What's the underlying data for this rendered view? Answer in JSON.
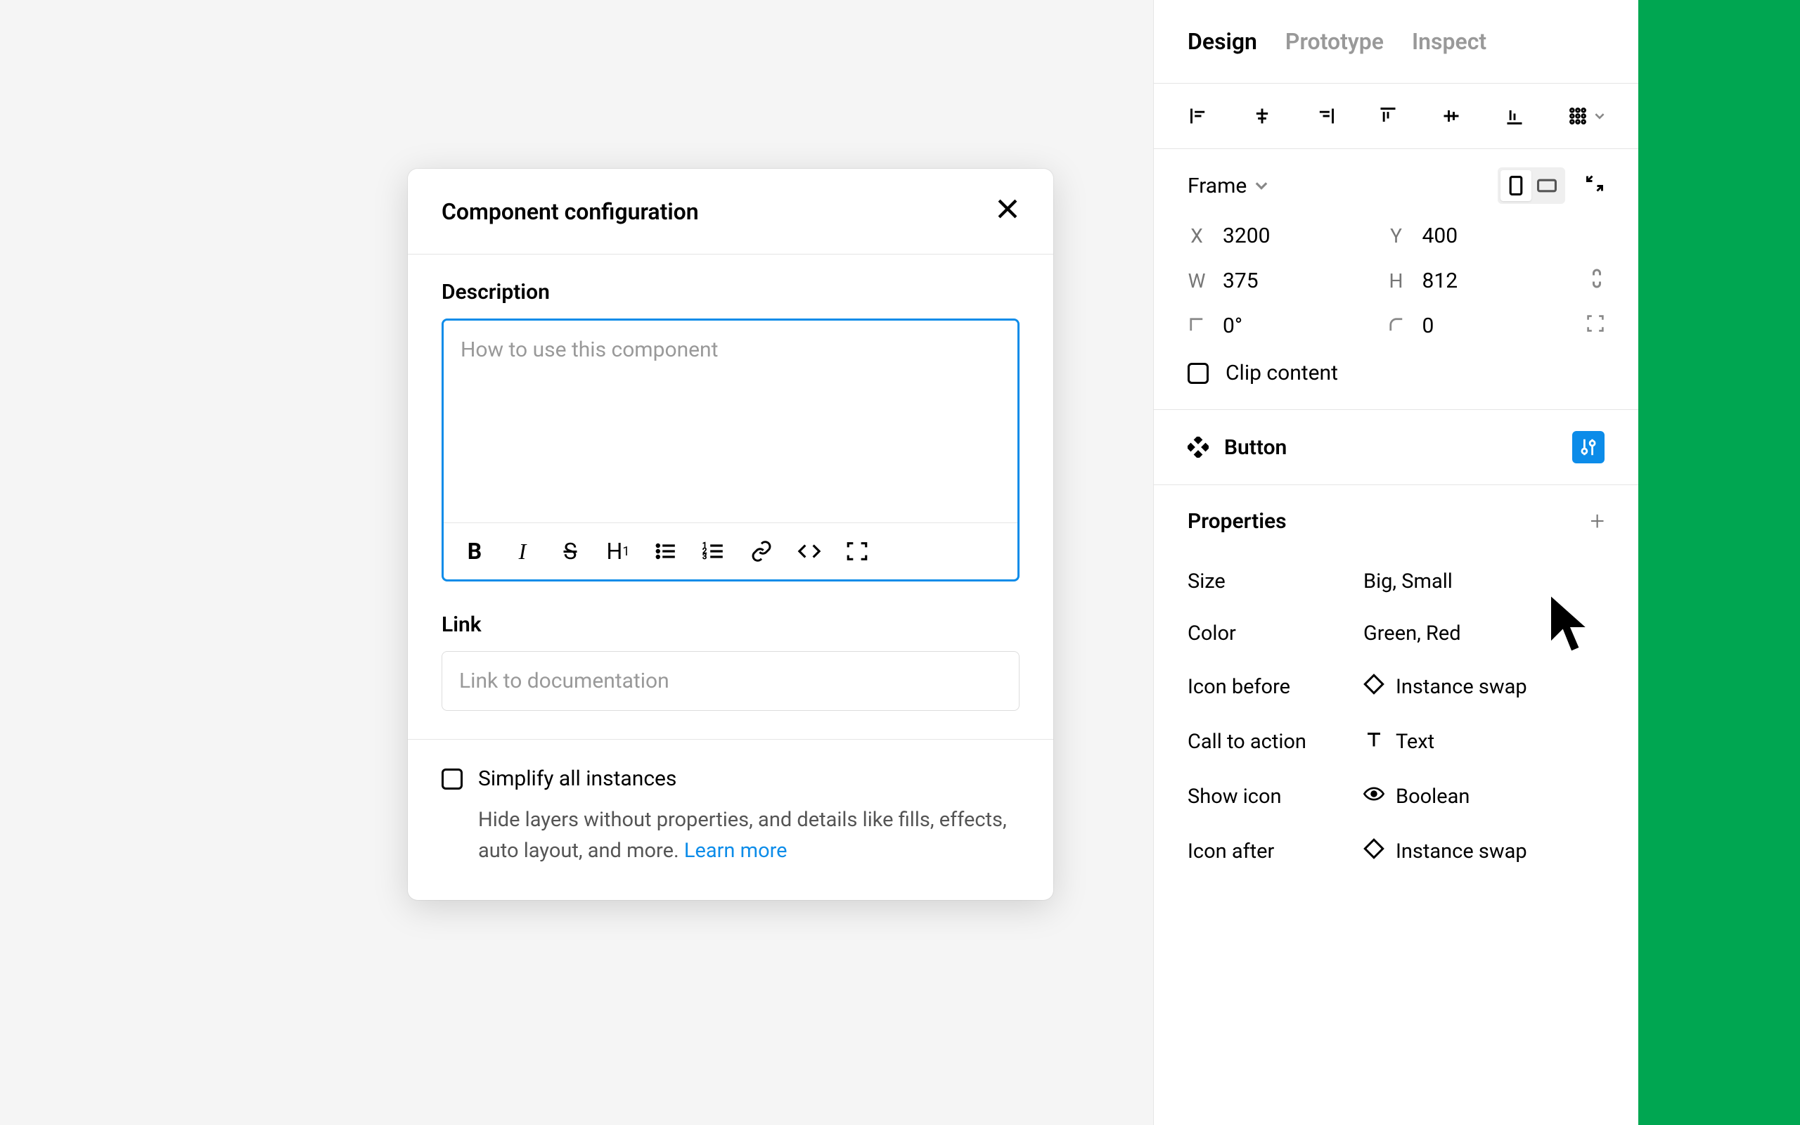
{
  "modal": {
    "title": "Component configuration",
    "description": {
      "label": "Description",
      "placeholder": "How to use this component"
    },
    "link": {
      "label": "Link",
      "placeholder": "Link to documentation"
    },
    "simplify": {
      "label": "Simplify all instances",
      "help": "Hide layers without properties, and details like fills, effects, auto layout, and more. ",
      "learn_more": "Learn more"
    }
  },
  "panel": {
    "tabs": {
      "design": "Design",
      "prototype": "Prototype",
      "inspect": "Inspect"
    },
    "frame": {
      "label": "Frame",
      "x_label": "X",
      "x": "3200",
      "y_label": "Y",
      "y": "400",
      "w_label": "W",
      "w": "375",
      "h_label": "H",
      "h": "812",
      "rotation": "0°",
      "radius": "0",
      "clip": "Clip content"
    },
    "component": {
      "name": "Button"
    },
    "properties": {
      "title": "Properties",
      "rows": [
        {
          "name": "Size",
          "value": "Big, Small",
          "type": "variant"
        },
        {
          "name": "Color",
          "value": "Green, Red",
          "type": "variant"
        },
        {
          "name": "Icon before",
          "value": "Instance swap",
          "type": "instance"
        },
        {
          "name": "Call to action",
          "value": "Text",
          "type": "text"
        },
        {
          "name": "Show icon",
          "value": "Boolean",
          "type": "boolean"
        },
        {
          "name": "Icon after",
          "value": "Instance swap",
          "type": "instance"
        }
      ]
    }
  }
}
